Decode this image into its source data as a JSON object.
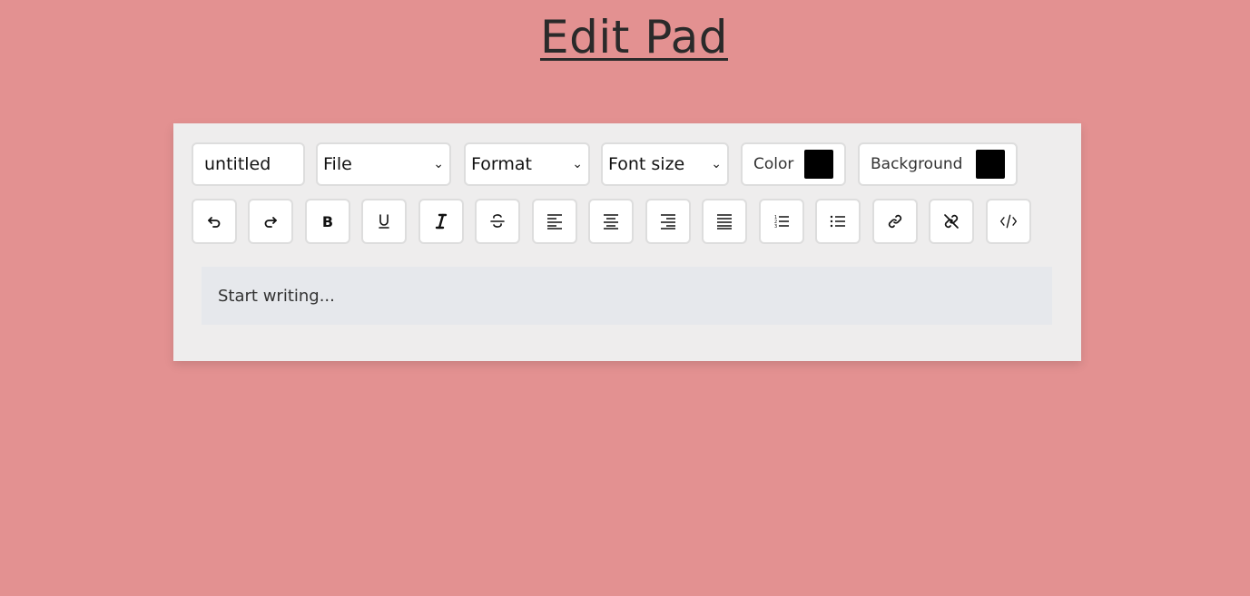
{
  "title": "Edit Pad",
  "toolbar": {
    "filename_value": "untitled",
    "file_select": "File",
    "format_select": "Format",
    "fontsize_select": "Font size",
    "color_label": "Color",
    "background_label": "Background",
    "color_value": "#000000",
    "background_value": "#000000"
  },
  "buttons": [
    {
      "name": "undo",
      "icon": "undo-icon"
    },
    {
      "name": "redo",
      "icon": "redo-icon"
    },
    {
      "name": "bold",
      "icon": "bold-icon"
    },
    {
      "name": "underline",
      "icon": "underline-icon"
    },
    {
      "name": "italic",
      "icon": "italic-icon"
    },
    {
      "name": "strikethrough",
      "icon": "strikethrough-icon"
    },
    {
      "name": "align-left",
      "icon": "align-left-icon"
    },
    {
      "name": "align-center",
      "icon": "align-center-icon"
    },
    {
      "name": "align-right",
      "icon": "align-right-icon"
    },
    {
      "name": "justify",
      "icon": "align-justify-icon"
    },
    {
      "name": "ordered-list",
      "icon": "ordered-list-icon"
    },
    {
      "name": "unordered-list",
      "icon": "unordered-list-icon"
    },
    {
      "name": "link",
      "icon": "link-icon"
    },
    {
      "name": "unlink",
      "icon": "unlink-icon"
    },
    {
      "name": "code",
      "icon": "code-icon"
    }
  ],
  "editor": {
    "placeholder": "Start writing..."
  },
  "colors": {
    "background": "#e39191",
    "panel": "#eeeded",
    "editor": "#e6e8ec"
  }
}
